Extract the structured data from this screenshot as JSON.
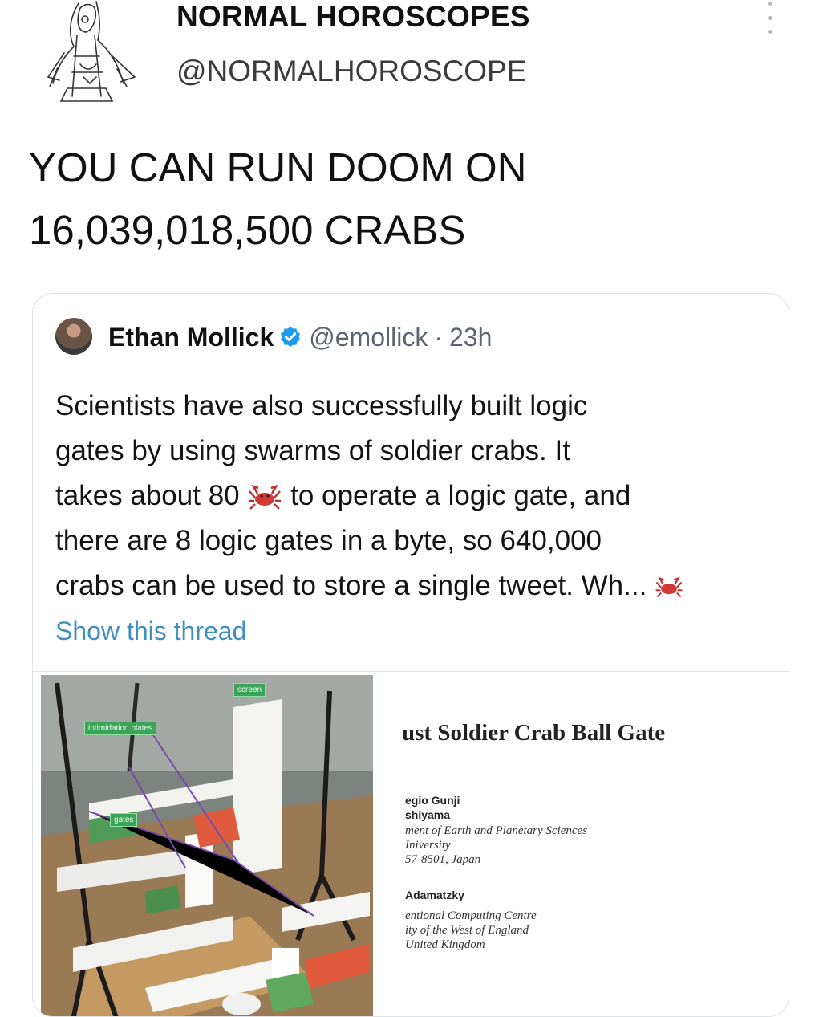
{
  "account": {
    "display_name": "NORMAL HOROSCOPES",
    "handle": "@NORMALHOROSCOPE",
    "avatar_icon": "sketch-figure-avatar"
  },
  "tweet": {
    "text_line1": "YOU CAN RUN DOOM ON",
    "text_line2": "16,039,018,500 CRABS"
  },
  "quoted_tweet": {
    "author_name": "Ethan Mollick",
    "verified_icon": "verified-badge-icon",
    "handle": "@emollick",
    "separator": "·",
    "time": "23h",
    "body_line1": "Scientists have also successfully built logic",
    "body_line2": "gates by using swarms of soldier crabs. It",
    "body_line3_a": "takes about 80",
    "body_line3_b": "to operate a logic gate, and",
    "body_line4": "there are 8 logic gates in a byte, so 640,000",
    "body_line5": "crabs can be used to store a single tweet. Wh...",
    "crab_emoji_icon": "crab-emoji-icon",
    "show_thread": "Show this thread",
    "accent_color": "#3f8fbf"
  },
  "media": {
    "photo_labels": {
      "screen": "screen",
      "intimidation": "intimidation plates",
      "gates": "gates"
    },
    "paper": {
      "title": "ust Soldier Crab Ball Gate",
      "author1": "egio Gunji",
      "author2": "shiyama",
      "affil1": "ment of Earth and Planetary Sciences",
      "affil2": "Iniversity",
      "affil3": "57-8501, Japan",
      "author3": "Adamatzky",
      "affil4": "entional Computing Centre",
      "affil5": "ity of the West of England",
      "affil6": "United Kingdom"
    }
  }
}
